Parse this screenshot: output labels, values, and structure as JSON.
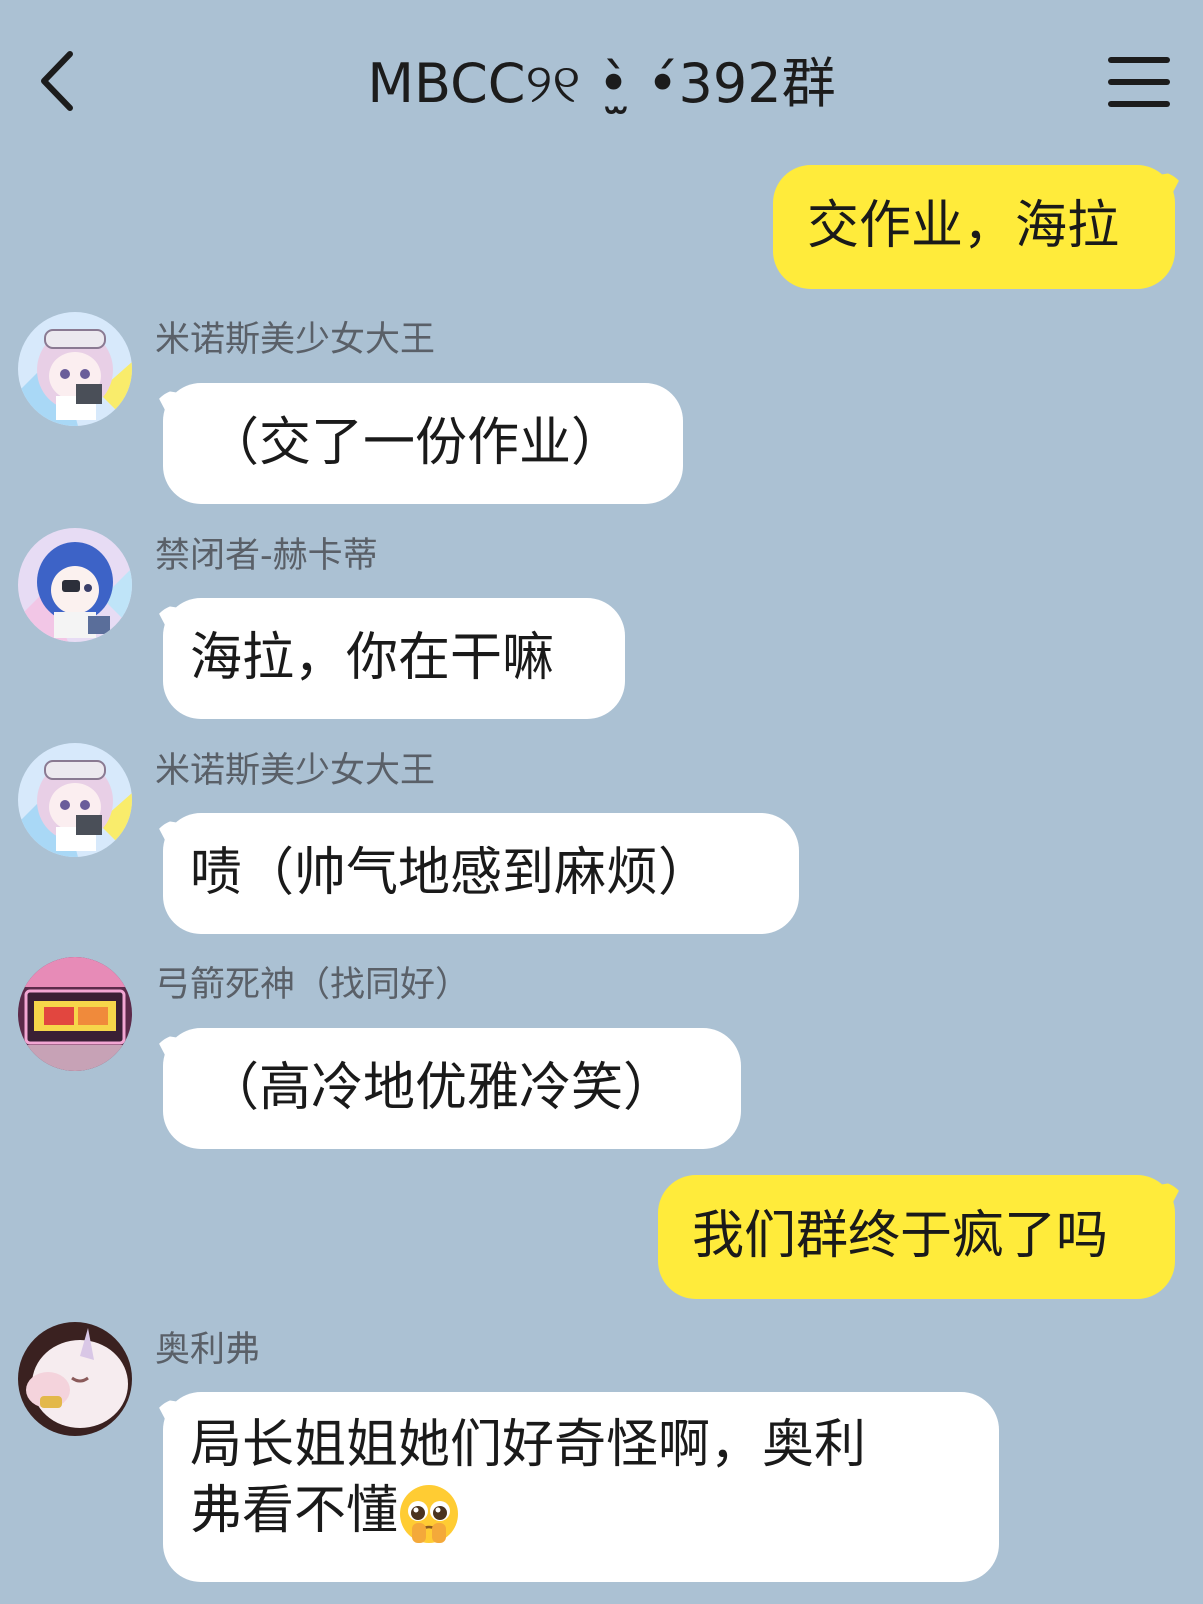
{
  "header": {
    "title": "MBCC୨୧ •̫̀ •́392群",
    "back_icon": "chevron-left-icon",
    "menu_icon": "hamburger-menu-icon"
  },
  "colors": {
    "background": "#abc1d3",
    "outgoing_bubble": "#ffeb3b",
    "incoming_bubble": "#ffffff",
    "sender_name": "#5a6068"
  },
  "messages": [
    {
      "direction": "out",
      "text": "交作业，海拉"
    },
    {
      "direction": "in",
      "sender": "米诺斯美少女大王",
      "text": "（交了一份作业）"
    },
    {
      "direction": "in",
      "sender": "禁闭者-赫卡蒂",
      "text": "海拉，你在干嘛"
    },
    {
      "direction": "in",
      "sender": "米诺斯美少女大王",
      "text": "啧（帅气地感到麻烦）"
    },
    {
      "direction": "in",
      "sender": "弓箭死神（找同好）",
      "text": "（高冷地优雅冷笑）"
    },
    {
      "direction": "out",
      "text": "我们群终于疯了吗"
    },
    {
      "direction": "in",
      "sender": "奥利弗",
      "text_line1": "局长姐姐她们好奇怪啊，奥利",
      "text_line2": "弗看不懂",
      "emoji": "pleading-face-icon"
    }
  ]
}
